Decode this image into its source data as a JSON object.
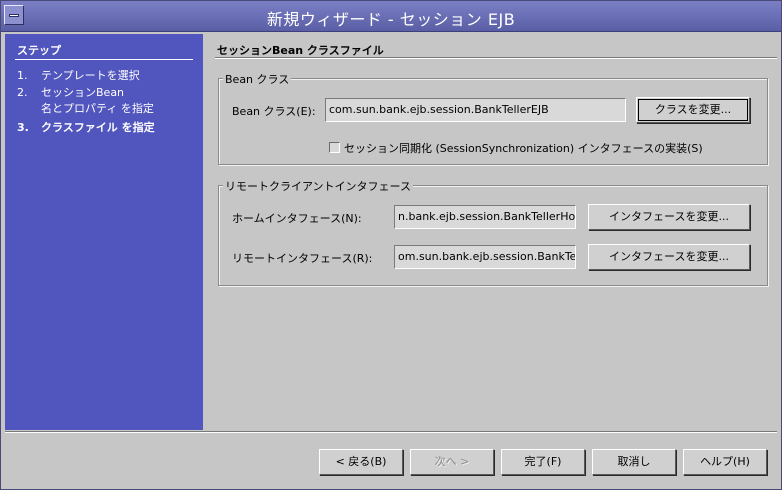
{
  "window": {
    "title": "新規ウィザード - セッション EJB"
  },
  "steps": {
    "header": "ステップ",
    "items": [
      {
        "num": "1.",
        "label": "テンプレートを選択"
      },
      {
        "num": "2.",
        "label": "セッションBean",
        "label2": "名とプロパティ を指定"
      },
      {
        "num": "3.",
        "label": "クラスファイル を指定"
      }
    ]
  },
  "panel": {
    "title": "セッションBean クラスファイル",
    "bean_group": {
      "title": "Bean クラス",
      "class_label": "Bean クラス(E):",
      "class_value": "com.sun.bank.ejb.session.BankTellerEJB",
      "change_class_button": "クラスを変更...",
      "sync_checkbox_label": "セッション同期化 (SessionSynchronization) インタフェースの実装(S)"
    },
    "remote_group": {
      "title": "リモートクライアントインタフェース",
      "home_label": "ホームインタフェース(N):",
      "home_value": "n.bank.ejb.session.BankTellerHome",
      "home_button": "インタフェースを変更...",
      "remote_label": "リモートインタフェース(R):",
      "remote_value": "om.sun.bank.ejb.session.BankTeller",
      "remote_button": "インタフェースを変更..."
    }
  },
  "footer": {
    "back": "< 戻る(B)",
    "next": "次へ >",
    "finish": "完了(F)",
    "cancel": "取消し",
    "help": "ヘルプ(H)"
  }
}
